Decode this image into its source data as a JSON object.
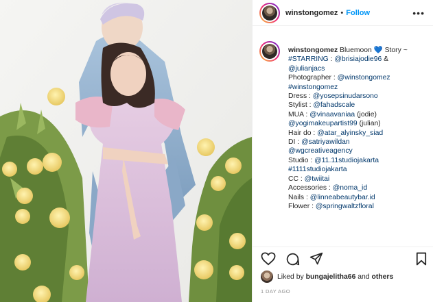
{
  "post": {
    "username": "winstongomez",
    "separator": "•",
    "follow_label": "Follow",
    "more_glyph": "•••"
  },
  "caption": {
    "username": "winstongomez",
    "title": "Bluemoon",
    "heart": "💙",
    "title_suffix": "Story ~",
    "lines": [
      [
        {
          "t": "#STARRING",
          "tag": true
        },
        {
          "t": " : ",
          "tag": false
        },
        {
          "t": "@brisiajodie96",
          "tag": true
        },
        {
          "t": " &",
          "tag": false
        }
      ],
      [
        {
          "t": "@julianjacs",
          "tag": true
        }
      ],
      [
        {
          "t": "Photographer : ",
          "tag": false
        },
        {
          "t": "@winstongomez",
          "tag": true
        }
      ],
      [
        {
          "t": "#winstongomez",
          "tag": true
        }
      ],
      [
        {
          "t": "Dress : ",
          "tag": false
        },
        {
          "t": "@yosepsinudarsono",
          "tag": true
        }
      ],
      [
        {
          "t": "Stylist : ",
          "tag": false
        },
        {
          "t": "@fahadscale",
          "tag": true
        }
      ],
      [
        {
          "t": "MUA : ",
          "tag": false
        },
        {
          "t": "@vinaavaniaa",
          "tag": true
        },
        {
          "t": " (jodie)",
          "tag": false
        }
      ],
      [
        {
          "t": "@yogimakeupartist99",
          "tag": true
        },
        {
          "t": " (julian)",
          "tag": false
        }
      ],
      [
        {
          "t": "Hair do : ",
          "tag": false
        },
        {
          "t": "@atar_alyinsky_siad",
          "tag": true
        }
      ],
      [
        {
          "t": "DI : ",
          "tag": false
        },
        {
          "t": "@satriyawildan",
          "tag": true
        }
      ],
      [
        {
          "t": "@wgcreativeagency",
          "tag": true
        }
      ],
      [
        {
          "t": "Studio : ",
          "tag": false
        },
        {
          "t": "@11.11studiojakarta",
          "tag": true
        }
      ],
      [
        {
          "t": "#1111studiojakarta",
          "tag": true
        }
      ],
      [
        {
          "t": "CC : ",
          "tag": false
        },
        {
          "t": "@twiitai",
          "tag": true
        }
      ],
      [
        {
          "t": "Accessories : ",
          "tag": false
        },
        {
          "t": "@noma_id",
          "tag": true
        }
      ],
      [
        {
          "t": "Nails : ",
          "tag": false
        },
        {
          "t": "@linneabeautybar.id",
          "tag": true
        }
      ],
      [
        {
          "t": "Flower : ",
          "tag": false
        },
        {
          "t": "@springwaltzfloral",
          "tag": true
        }
      ]
    ]
  },
  "likes": {
    "prefix": "Liked by",
    "user": "bungajelitha66",
    "middle": "and",
    "others": "others"
  },
  "timestamp": "1 DAY AGO",
  "icons": {
    "like": "heart-outline-icon",
    "comment": "comment-icon",
    "share": "paper-plane-icon",
    "save": "bookmark-icon"
  },
  "colors": {
    "link_blue": "#0095f6",
    "tag_blue": "#00376b",
    "heart_blue": "#3897f0",
    "text": "#262626",
    "muted": "#8e8e8e"
  }
}
